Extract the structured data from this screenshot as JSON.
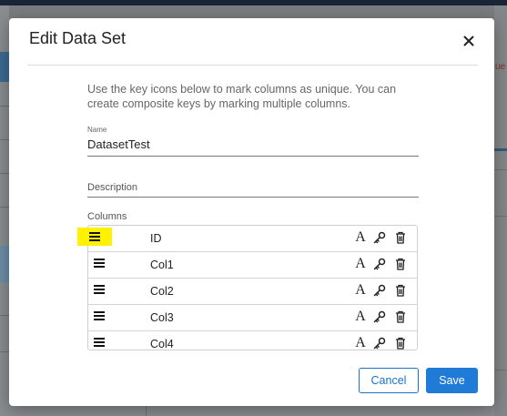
{
  "dialog": {
    "title": "Edit Data Set",
    "instructions": "Use the key icons below to mark columns as unique. You can create composite keys by marking multiple columns.",
    "name_label": "Name",
    "name_value": "DatasetTest",
    "description_placeholder": "Description",
    "columns_label": "Columns",
    "columns": [
      {
        "name": "ID"
      },
      {
        "name": "Col1"
      },
      {
        "name": "Col2"
      },
      {
        "name": "Col3"
      },
      {
        "name": "Col4"
      }
    ],
    "column_type_glyph": "A",
    "cancel_label": "Cancel",
    "save_label": "Save"
  },
  "background": {
    "partial_text": "ue"
  },
  "colors": {
    "accent": "#1f7bd6",
    "highlight": "#fff200",
    "overlay": "#7a7d80"
  },
  "icons": [
    "close-icon",
    "drag-handle-icon",
    "text-type-icon",
    "key-icon",
    "trash-icon"
  ]
}
